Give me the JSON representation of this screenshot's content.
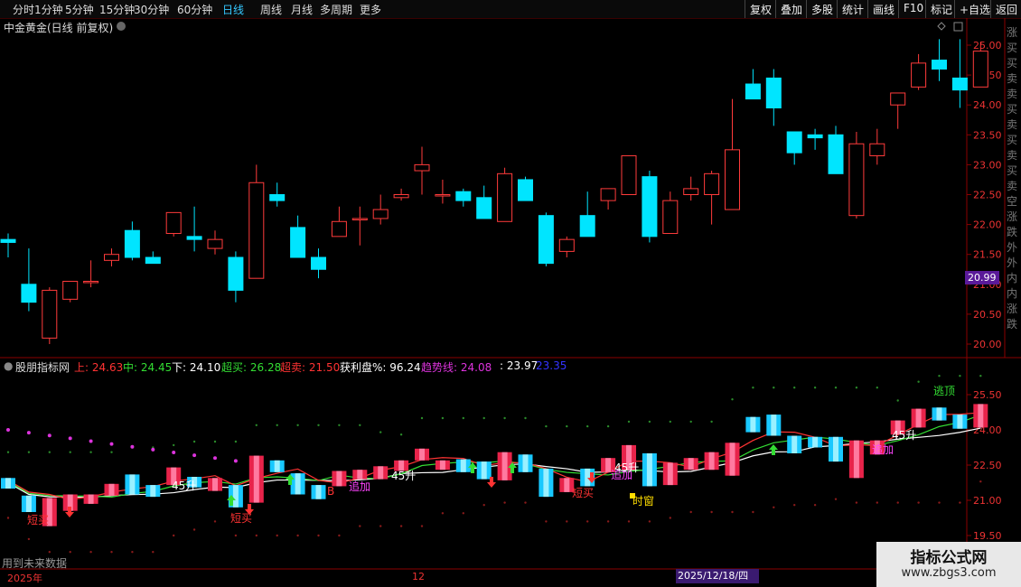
{
  "toolbar": {
    "periods": [
      "分时",
      "1分钟",
      "5分钟",
      "15分钟",
      "30分钟",
      "60分钟",
      "日线",
      "周线",
      "月线",
      "多周期",
      "更多"
    ],
    "active_period": "日线",
    "right_buttons": [
      "复权",
      "叠加",
      "多股",
      "统计",
      "画线",
      "F10",
      "标记",
      "+自选",
      "返回"
    ]
  },
  "main_chart": {
    "title": "中金黄金(日线 前复权)",
    "y_ticks": [
      "25.00",
      "24.50",
      "24.00",
      "23.50",
      "23.00",
      "22.50",
      "22.00",
      "21.50",
      "21.00",
      "20.50",
      "20.00"
    ],
    "current_price": "20.99",
    "right_sidebar_text": "涨买买卖卖买卖买卖买卖空涨跌外外内内涨跌"
  },
  "indicator": {
    "name": "股朋指标网",
    "legend": [
      {
        "label": "上: 24.63",
        "color": "#ff3333"
      },
      {
        "label": "中: 24.45",
        "color": "#33dd33"
      },
      {
        "label": "下: 24.10",
        "color": "#ffffff"
      },
      {
        "label": "超买: 26.28",
        "color": "#33dd33"
      },
      {
        "label": "超卖: 21.50",
        "color": "#ff3333"
      },
      {
        "label": "获利盘%: 96.24",
        "color": "#ffffff"
      },
      {
        "label": "趋势线: 24.08",
        "color": "#dd33dd"
      },
      {
        "label": ": 23.97",
        "color": "#ffffff"
      },
      {
        "label": "23.35",
        "color": "#3333ff"
      }
    ],
    "y_ticks": [
      "25.50",
      "24.00",
      "22.50",
      "21.00",
      "19.50"
    ],
    "annotations": [
      {
        "text": "短买",
        "color": "#ff3333"
      },
      {
        "text": "短买",
        "color": "#ff3333"
      },
      {
        "text": "短买",
        "color": "#ff3333"
      },
      {
        "text": "B",
        "color": "#ff3333"
      },
      {
        "text": "追加",
        "color": "#ff44ff"
      },
      {
        "text": "追加",
        "color": "#ff44ff"
      },
      {
        "text": "追加",
        "color": "#ff44ff"
      },
      {
        "text": "逃顶",
        "color": "#33dd33"
      },
      {
        "text": "时窗",
        "color": "#ffdd00"
      },
      {
        "text": "45升",
        "color": "#ffffff"
      },
      {
        "text": "45升",
        "color": "#ffffff"
      },
      {
        "text": "45升",
        "color": "#ffffff"
      },
      {
        "text": "45升",
        "color": "#ffffff"
      }
    ]
  },
  "bottom": {
    "note": "用到未来数据",
    "date_labels": [
      "2025年",
      "12"
    ],
    "selected_date": "2025/12/18/四"
  },
  "watermark": {
    "title": "指标公式网",
    "url": "www.zbgs3.com"
  },
  "colors": {
    "up": "#ff3b3b",
    "down": "#00e5ff",
    "bg": "#000000",
    "axis": "#8b0000"
  },
  "candles": [
    [
      21.75,
      21.85,
      21.45,
      21.7
    ],
    [
      21.0,
      21.6,
      20.55,
      20.7
    ],
    [
      20.1,
      20.95,
      20.0,
      20.9
    ],
    [
      20.75,
      21.05,
      20.7,
      21.05
    ],
    [
      21.05,
      21.4,
      20.95,
      21.05
    ],
    [
      21.4,
      21.6,
      21.3,
      21.5
    ],
    [
      21.9,
      22.05,
      21.4,
      21.45
    ],
    [
      21.45,
      21.55,
      21.35,
      21.35
    ],
    [
      21.85,
      22.15,
      21.8,
      22.2
    ],
    [
      21.8,
      22.3,
      21.55,
      21.75
    ],
    [
      21.6,
      21.9,
      21.5,
      21.75
    ],
    [
      21.45,
      21.55,
      20.7,
      20.9
    ],
    [
      21.1,
      23.0,
      21.1,
      22.7
    ],
    [
      22.5,
      22.7,
      22.3,
      22.4
    ],
    [
      21.95,
      22.15,
      21.45,
      21.45
    ],
    [
      21.45,
      21.6,
      21.1,
      21.25
    ],
    [
      21.8,
      22.3,
      21.8,
      22.05
    ],
    [
      22.1,
      22.3,
      21.65,
      22.1
    ],
    [
      22.1,
      22.5,
      22.0,
      22.25
    ],
    [
      22.45,
      22.6,
      22.4,
      22.5
    ],
    [
      22.9,
      23.3,
      22.5,
      23.0
    ],
    [
      22.5,
      22.75,
      22.35,
      22.5
    ],
    [
      22.55,
      22.6,
      22.3,
      22.4
    ],
    [
      22.45,
      22.65,
      22.1,
      22.1
    ],
    [
      22.05,
      22.95,
      22.1,
      22.85
    ],
    [
      22.75,
      22.8,
      22.4,
      22.4
    ],
    [
      22.15,
      22.2,
      21.3,
      21.35
    ],
    [
      21.55,
      21.8,
      21.45,
      21.75
    ],
    [
      22.15,
      22.55,
      21.8,
      21.8
    ],
    [
      22.4,
      22.55,
      22.25,
      22.6
    ],
    [
      22.5,
      23.15,
      22.5,
      23.15
    ],
    [
      22.8,
      22.9,
      21.7,
      21.8
    ],
    [
      21.85,
      22.55,
      21.9,
      22.4
    ],
    [
      22.5,
      22.8,
      22.4,
      22.6
    ],
    [
      22.5,
      22.9,
      22.0,
      22.85
    ],
    [
      22.25,
      24.1,
      22.25,
      23.25
    ],
    [
      24.35,
      24.6,
      24.1,
      24.1
    ],
    [
      24.45,
      24.6,
      23.65,
      23.95
    ],
    [
      23.55,
      23.55,
      23.0,
      23.2
    ],
    [
      23.5,
      23.6,
      23.25,
      23.45
    ],
    [
      23.5,
      23.65,
      22.85,
      22.85
    ],
    [
      22.15,
      23.55,
      22.1,
      23.35
    ],
    [
      23.15,
      23.6,
      23.0,
      23.35
    ],
    [
      24.0,
      24.05,
      23.6,
      24.2
    ],
    [
      24.3,
      24.85,
      24.25,
      24.7
    ],
    [
      24.75,
      25.1,
      24.4,
      24.6
    ],
    [
      24.45,
      25.1,
      23.95,
      24.25
    ],
    [
      24.3,
      25.05,
      24.3,
      24.9
    ]
  ]
}
